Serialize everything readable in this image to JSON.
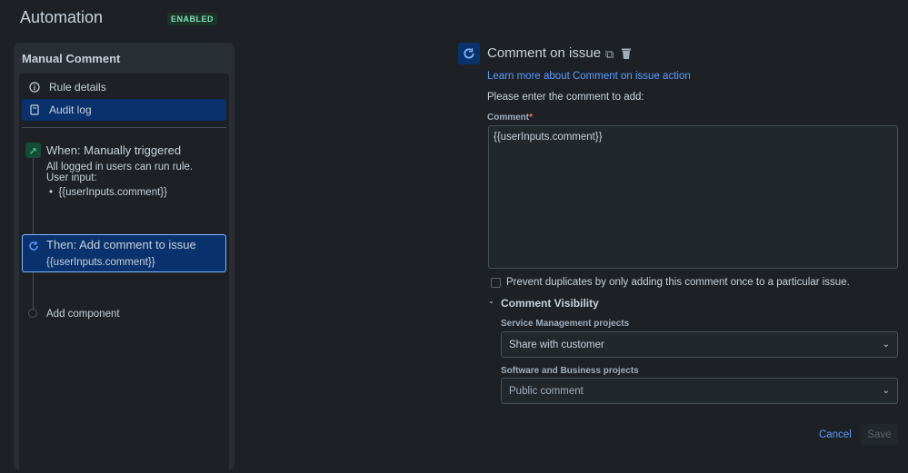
{
  "header": {
    "title": "Automation",
    "status": "ENABLED"
  },
  "rule": {
    "name": "Manual Comment",
    "nav": [
      {
        "label": "Rule details",
        "icon": "info-icon"
      },
      {
        "label": "Audit log",
        "icon": "document-icon"
      }
    ],
    "trigger": {
      "title": "When: Manually triggered",
      "line1": "All logged in users can run rule.",
      "line2": "User input:",
      "bullet": "{{userInputs.comment}}"
    },
    "action": {
      "title": "Then: Add comment to issue",
      "detail": "{{userInputs.comment}}"
    },
    "add_component": "Add component"
  },
  "editor": {
    "title": "Comment on issue",
    "learn_link": "Learn more about Comment on issue action",
    "instruction": "Please enter the comment to add:",
    "comment_label": "Comment",
    "required": "*",
    "comment_value": "{{userInputs.comment}}",
    "prevent_duplicates": "Prevent duplicates by only adding this comment once to a particular issue.",
    "prevent_checked": false,
    "visibility_title": "Comment Visibility",
    "service_label": "Service Management projects",
    "service_value": "Share with customer",
    "software_label": "Software and Business projects",
    "software_value": "Public comment",
    "cancel": "Cancel",
    "save": "Save"
  }
}
